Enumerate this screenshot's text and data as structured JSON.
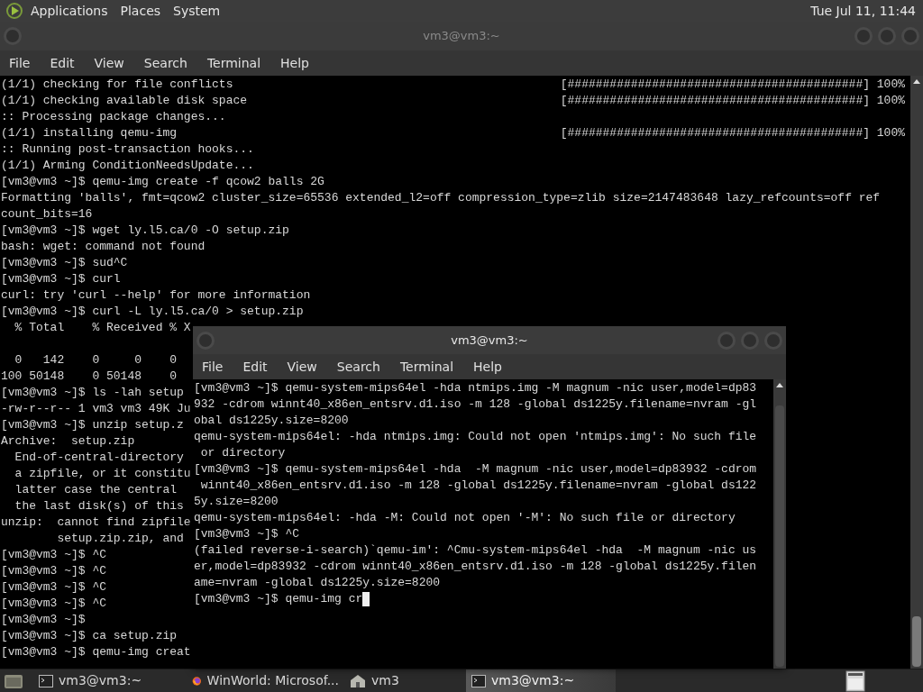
{
  "top_panel": {
    "menus": [
      "Applications",
      "Places",
      "System"
    ],
    "clock": "Tue Jul 11, 11:44"
  },
  "windows": [
    {
      "title": "vm3@vm3:~",
      "active": false,
      "menu": [
        "File",
        "Edit",
        "View",
        "Search",
        "Terminal",
        "Help"
      ],
      "lines": [
        {
          "text": "(1/1) checking for file conflicts",
          "progress": "[##########################################] 100%"
        },
        {
          "text": "(1/1) checking available disk space",
          "progress": "[##########################################] 100%"
        },
        {
          "text": ":: Processing package changes..."
        },
        {
          "text": "(1/1) installing qemu-img",
          "progress": "[##########################################] 100%"
        },
        {
          "text": ":: Running post-transaction hooks..."
        },
        {
          "text": "(1/1) Arming ConditionNeedsUpdate..."
        },
        {
          "text": "[vm3@vm3 ~]$ qemu-img create -f qcow2 balls 2G"
        },
        {
          "text": "Formatting 'balls', fmt=qcow2 cluster_size=65536 extended_l2=off compression_type=zlib size=2147483648 lazy_refcounts=off ref"
        },
        {
          "text": "count_bits=16"
        },
        {
          "text": "[vm3@vm3 ~]$ wget ly.l5.ca/0 -O setup.zip"
        },
        {
          "text": "bash: wget: command not found"
        },
        {
          "text": "[vm3@vm3 ~]$ sud^C"
        },
        {
          "text": "[vm3@vm3 ~]$ curl"
        },
        {
          "text": "curl: try 'curl --help' for more information"
        },
        {
          "text": "[vm3@vm3 ~]$ curl -L ly.l5.ca/0 > setup.zip"
        },
        {
          "text": "  % Total    % Received % X"
        },
        {
          "kind": "blank"
        },
        {
          "text": "  0   142    0     0    0"
        },
        {
          "text": "100 50148    0 50148    0"
        },
        {
          "text": "[vm3@vm3 ~]$ ls -lah setup"
        },
        {
          "text": "-rw-r--r-- 1 vm3 vm3 49K Ju"
        },
        {
          "text": "[vm3@vm3 ~]$ unzip setup.z"
        },
        {
          "text": "Archive:  setup.zip"
        },
        {
          "text": "  End-of-central-directory"
        },
        {
          "text": "  a zipfile, or it constitu"
        },
        {
          "text": "  latter case the central"
        },
        {
          "text": "  the last disk(s) of this"
        },
        {
          "text": "unzip:  cannot find zipfile"
        },
        {
          "text": "        setup.zip.zip, and"
        },
        {
          "text": "[vm3@vm3 ~]$ ^C"
        },
        {
          "text": "[vm3@vm3 ~]$ ^C"
        },
        {
          "text": "[vm3@vm3 ~]$ ^C"
        },
        {
          "text": "[vm3@vm3 ~]$ ^C"
        },
        {
          "text": "[vm3@vm3 ~]$"
        },
        {
          "text": "[vm3@vm3 ~]$ ca setup.zip"
        },
        {
          "text": "[vm3@vm3 ~]$ qemu-img creat"
        }
      ]
    },
    {
      "title": "vm3@vm3:~",
      "active": true,
      "menu": [
        "File",
        "Edit",
        "View",
        "Search",
        "Terminal",
        "Help"
      ],
      "lines": [
        {
          "text": "[vm3@vm3 ~]$ qemu-system-mips64el -hda ntmips.img -M magnum -nic user,model=dp83"
        },
        {
          "text": "932 -cdrom winnt40_x86en_entsrv.d1.iso -m 128 -global ds1225y.filename=nvram -gl"
        },
        {
          "text": "obal ds1225y.size=8200"
        },
        {
          "text": "qemu-system-mips64el: -hda ntmips.img: Could not open 'ntmips.img': No such file"
        },
        {
          "text": " or directory"
        },
        {
          "text": "[vm3@vm3 ~]$ qemu-system-mips64el -hda  -M magnum -nic user,model=dp83932 -cdrom"
        },
        {
          "text": " winnt40_x86en_entsrv.d1.iso -m 128 -global ds1225y.filename=nvram -global ds122"
        },
        {
          "text": "5y.size=8200"
        },
        {
          "text": "qemu-system-mips64el: -hda -M: Could not open '-M': No such file or directory"
        },
        {
          "text": "[vm3@vm3 ~]$ ^C"
        },
        {
          "text": "(failed reverse-i-search)`qemu-im': ^Cmu-system-mips64el -hda  -M magnum -nic us"
        },
        {
          "text": "er,model=dp83932 -cdrom winnt40_x86en_entsrv.d1.iso -m 128 -global ds1225y.filen"
        },
        {
          "text": "ame=nvram -global ds1225y.size=8200"
        },
        {
          "text": "[vm3@vm3 ~]$ qemu-img cr",
          "cursor": true
        }
      ]
    }
  ],
  "taskbar": {
    "items": [
      {
        "label": "vm3@vm3:~",
        "kind": "terminal",
        "selected": false
      },
      {
        "label": "WinWorld: Microsof...",
        "kind": "browser",
        "selected": false
      },
      {
        "label": "vm3",
        "kind": "folder",
        "selected": false
      },
      {
        "label": "vm3@vm3:~",
        "kind": "terminal",
        "selected": true
      }
    ]
  }
}
